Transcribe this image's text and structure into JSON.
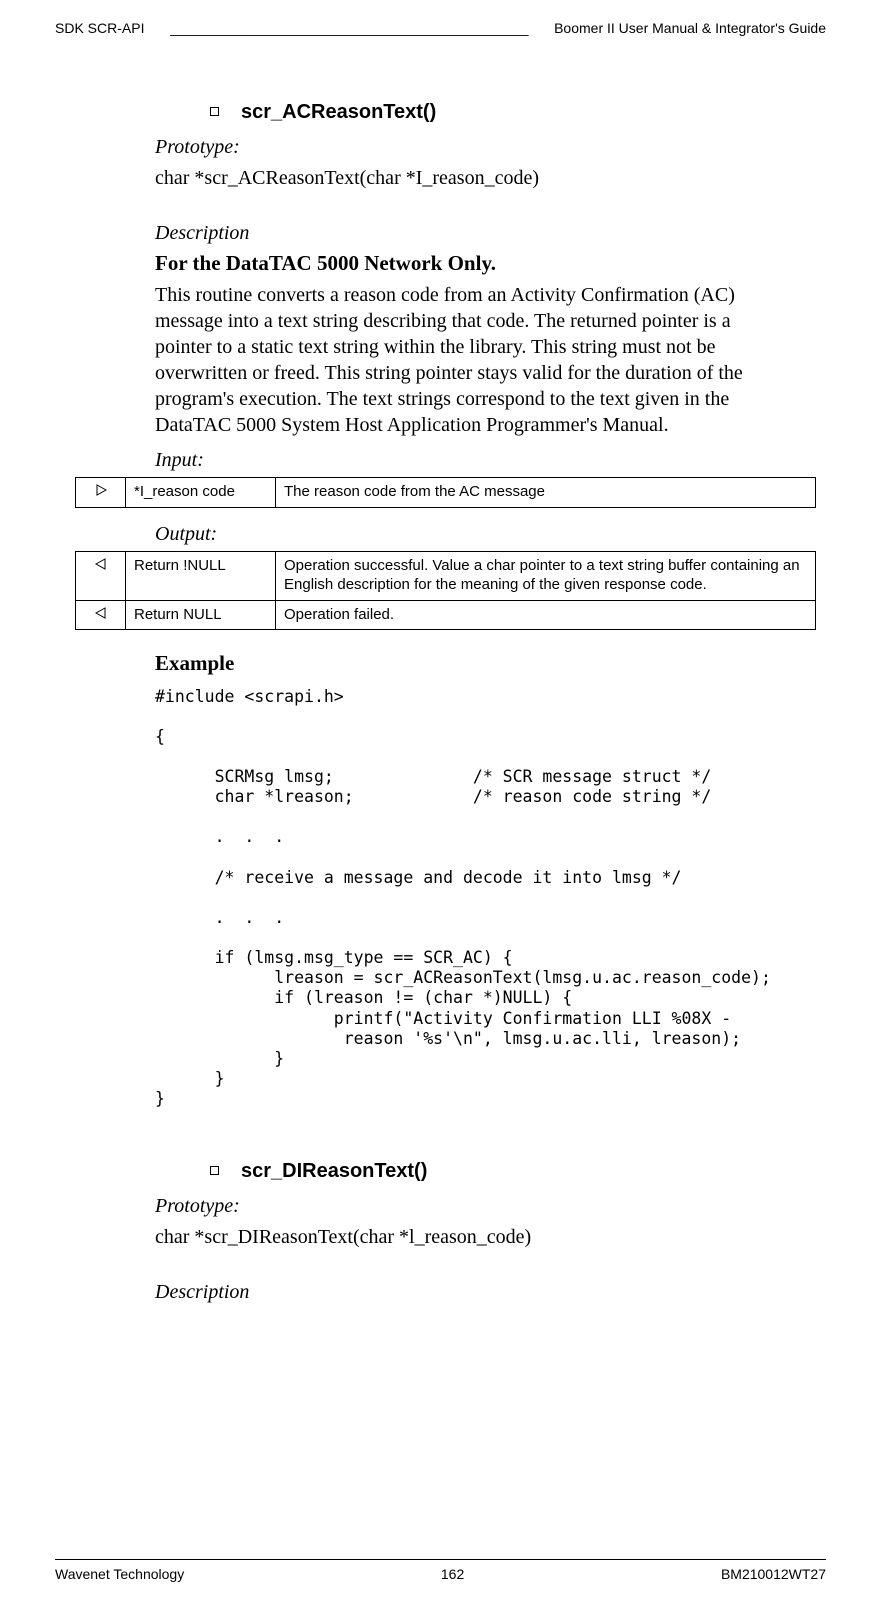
{
  "header": {
    "left": "SDK SCR-API",
    "right": "Boomer II User Manual & Integrator's Guide"
  },
  "footer": {
    "left": "Wavenet Technology",
    "center": "162",
    "right": "BM210012WT27"
  },
  "sections": [
    {
      "title": "scr_ACReasonText()",
      "proto_label": "Prototype:",
      "proto": "char *scr_ACReasonText(char *I_reason_code)",
      "desc_label": "Description",
      "desc_bold": "For the DataTAC 5000 Network Only",
      "desc_body": "This routine converts a reason code from an Activity Confirmation (AC) message into a text string describing that code. The returned pointer is a pointer to a static text string within the library. This string must not be overwritten or freed. This string pointer stays valid for the duration of the program's execution. The text strings correspond to the text given in the DataTAC 5000 System Host Application Programmer's Manual.",
      "input_label": "Input:",
      "input_table": [
        {
          "arrow": "right",
          "name": "*I_reason code",
          "desc": "The reason code from the AC message"
        }
      ],
      "output_label": "Output:",
      "output_table": [
        {
          "arrow": "left",
          "name": "Return !NULL",
          "desc": "Operation successful. Value a char pointer to a text string buffer containing an English description for the meaning of the given response code."
        },
        {
          "arrow": "left",
          "name": "Return NULL",
          "desc": "Operation failed."
        }
      ],
      "example_label": "Example",
      "code": "#include <scrapi.h>\n\n{\n\n      SCRMsg lmsg;              /* SCR message struct */\n      char *lreason;            /* reason code string */\n\n      .  .  .\n\n      /* receive a message and decode it into lmsg */\n\n      .  .  .\n\n      if (lmsg.msg_type == SCR_AC) {\n            lreason = scr_ACReasonText(lmsg.u.ac.reason_code);\n            if (lreason != (char *)NULL) {\n                  printf(\"Activity Confirmation LLI %08X -\n                   reason '%s'\\n\", lmsg.u.ac.lli, lreason);\n            }\n      }\n}"
    },
    {
      "title": "scr_DIReasonText()",
      "proto_label": "Prototype:",
      "proto": "char *scr_DIReasonText(char *l_reason_code)",
      "desc_label": "Description"
    }
  ]
}
